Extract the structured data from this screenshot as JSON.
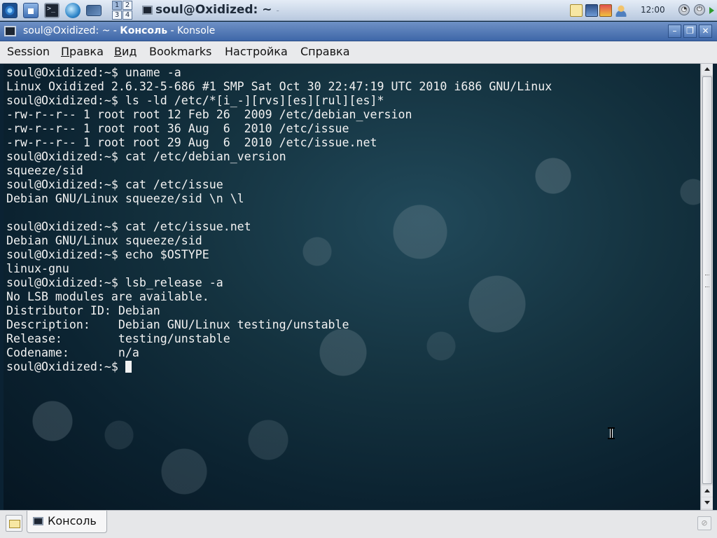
{
  "panel": {
    "pager_desktops": [
      "1",
      "2",
      "3",
      "4"
    ],
    "taskbar_title": "soul@Oxidized: ~",
    "taskbar_title_dash": "-",
    "clock": "12:00"
  },
  "window": {
    "title_prefix": "soul@Oxidized: ~ - ",
    "title_bold": "Консоль",
    "title_suffix": " - Konsole"
  },
  "menu": {
    "items": [
      {
        "label": "Session",
        "mnemonic": ""
      },
      {
        "label": "равка",
        "mnemonic": "П"
      },
      {
        "label": "ид",
        "mnemonic": "В"
      },
      {
        "label": "Bookmarks",
        "mnemonic": ""
      },
      {
        "label": "Настройка",
        "mnemonic": ""
      },
      {
        "label": "Справка",
        "mnemonic": ""
      }
    ]
  },
  "terminal": {
    "lines": [
      "soul@Oxidized:~$ uname -a",
      "Linux Oxidized 2.6.32-5-686 #1 SMP Sat Oct 30 22:47:19 UTC 2010 i686 GNU/Linux",
      "soul@Oxidized:~$ ls -ld /etc/*[i_-][rvs][es][rul][es]*",
      "-rw-r--r-- 1 root root 12 Feb 26  2009 /etc/debian_version",
      "-rw-r--r-- 1 root root 36 Aug  6  2010 /etc/issue",
      "-rw-r--r-- 1 root root 29 Aug  6  2010 /etc/issue.net",
      "soul@Oxidized:~$ cat /etc/debian_version",
      "squeeze/sid",
      "soul@Oxidized:~$ cat /etc/issue",
      "Debian GNU/Linux squeeze/sid \\n \\l",
      "",
      "soul@Oxidized:~$ cat /etc/issue.net",
      "Debian GNU/Linux squeeze/sid",
      "soul@Oxidized:~$ echo $OSTYPE",
      "linux-gnu",
      "soul@Oxidized:~$ lsb_release -a",
      "No LSB modules are available.",
      "Distributor ID: Debian",
      "Description:    Debian GNU/Linux testing/unstable",
      "Release:        testing/unstable",
      "Codename:       n/a"
    ],
    "prompt": "soul@Oxidized:~$ "
  },
  "tabs": {
    "items": [
      {
        "label": "Консоль"
      }
    ]
  },
  "colors": {
    "title_bar": "#4a72b2",
    "terminal_text": "#f2f2f2",
    "terminal_bg": "#14323f"
  }
}
